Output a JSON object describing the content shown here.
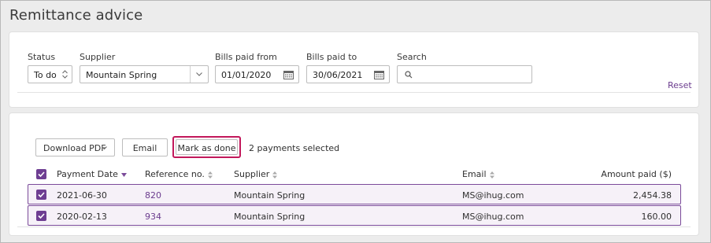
{
  "page": {
    "title": "Remittance advice"
  },
  "filters": {
    "status": {
      "label": "Status",
      "value": "To do"
    },
    "supplier": {
      "label": "Supplier",
      "value": "Mountain Spring"
    },
    "bills_from": {
      "label": "Bills paid from",
      "value": "01/01/2020"
    },
    "bills_to": {
      "label": "Bills paid to",
      "value": "30/06/2021"
    },
    "search": {
      "label": "Search",
      "value": "",
      "placeholder": ""
    },
    "reset_label": "Reset"
  },
  "toolbar": {
    "download_pdf_label": "Download PDF",
    "email_label": "Email",
    "mark_done_label": "Mark as done",
    "selected_text": "2 payments selected"
  },
  "table": {
    "columns": {
      "payment_date": "Payment Date",
      "reference": "Reference no.",
      "supplier": "Supplier",
      "email": "Email",
      "amount": "Amount paid ($)"
    },
    "rows": [
      {
        "payment_date": "2021-06-30",
        "reference": "820",
        "supplier": "Mountain Spring",
        "email": "MS@ihug.com",
        "amount": "2,454.38",
        "checked": true
      },
      {
        "payment_date": "2020-02-13",
        "reference": "934",
        "supplier": "Mountain Spring",
        "email": "MS@ihug.com",
        "amount": "160.00",
        "checked": true
      }
    ]
  },
  "colors": {
    "accent": "#6e3e92",
    "highlight": "#c2185b",
    "row_bg": "#f6f1f8"
  }
}
